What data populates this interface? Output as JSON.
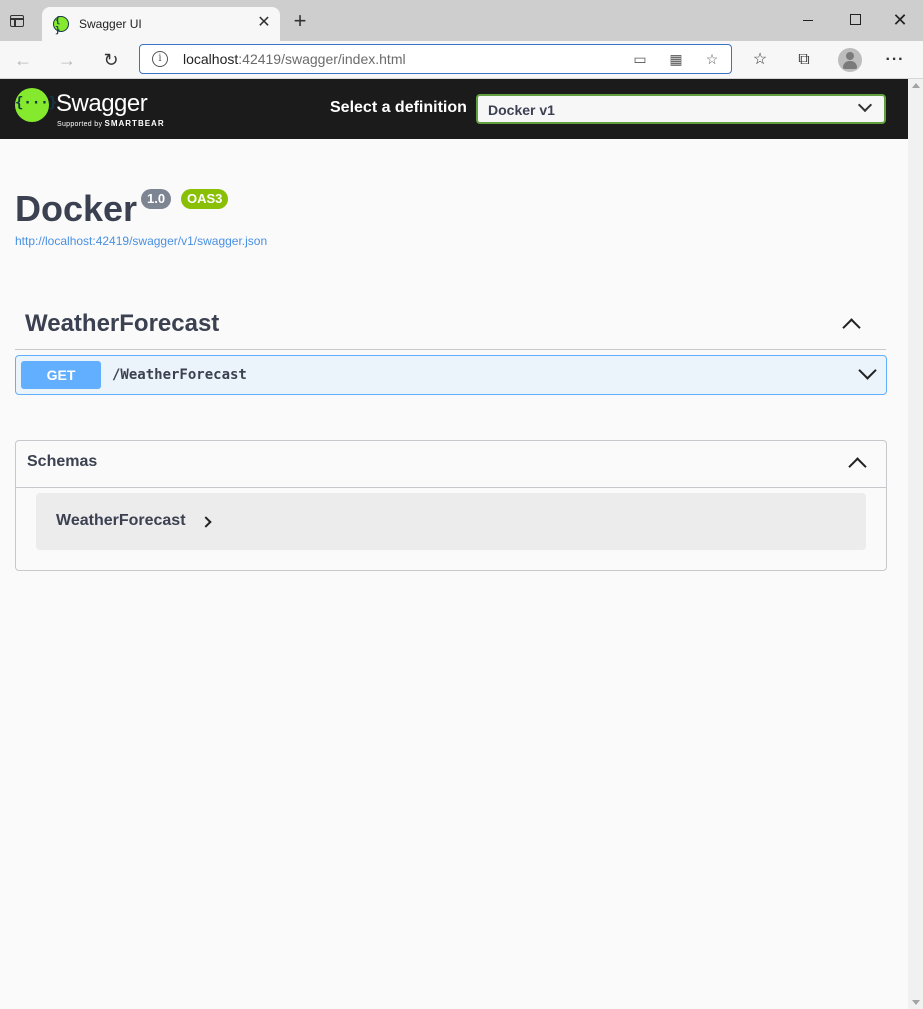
{
  "browser": {
    "tab_title": "Swagger UI",
    "tab_close": "✕",
    "new_tab": "+",
    "url_host": "localhost",
    "url_rest": ":42419/swagger/index.html",
    "info_glyph": "i",
    "more_glyph": "···",
    "close_glyph": "✕"
  },
  "topbar": {
    "logo_glyph": "{···}",
    "brand": "Swagger",
    "supported_by": "Supported by",
    "smartbear": "SMARTBEAR",
    "select_label": "Select a definition",
    "selected_definition": "Docker v1"
  },
  "info": {
    "title": "Docker",
    "version": "1.0",
    "oas": "OAS3",
    "spec_url": "http://localhost:42419/swagger/v1/swagger.json"
  },
  "tags": [
    {
      "name": "WeatherForecast",
      "operations": [
        {
          "method": "GET",
          "path": "/WeatherForecast"
        }
      ]
    }
  ],
  "schemas": {
    "title": "Schemas",
    "models": [
      {
        "name": "WeatherForecast"
      }
    ]
  },
  "colors": {
    "get_method": "#61affe",
    "get_background": "#ebf3fb",
    "swagger_green": "#85ea2d",
    "version_badge": "#7d8492",
    "oas_badge": "#89bf04",
    "link": "#4990e2"
  }
}
